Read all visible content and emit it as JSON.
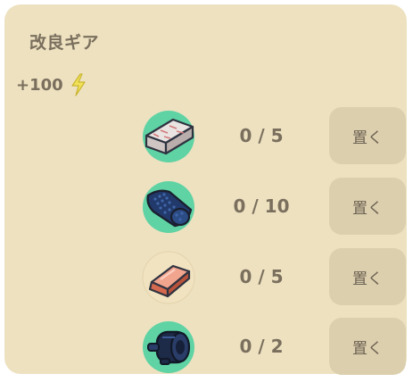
{
  "header": {
    "title": "改良ギア"
  },
  "reward": {
    "amount": "+100",
    "icon": "lightning-bolt-icon",
    "color": "#f2e25a"
  },
  "items": [
    {
      "name": "ice-block-stack-icon",
      "count": "0 / 5",
      "button": "置く",
      "icon_bg": "#5fd3a4"
    },
    {
      "name": "dark-blue-cloth-roll-icon",
      "count": "0 / 10",
      "button": "置く",
      "icon_bg": "#5fd3a4"
    },
    {
      "name": "copper-ingot-icon",
      "count": "0 / 5",
      "button": "置く",
      "icon_bg": "#f1e2c0"
    },
    {
      "name": "dark-motor-engine-icon",
      "count": "0 / 2",
      "button": "置く",
      "icon_bg": "#5fd3a4"
    }
  ]
}
